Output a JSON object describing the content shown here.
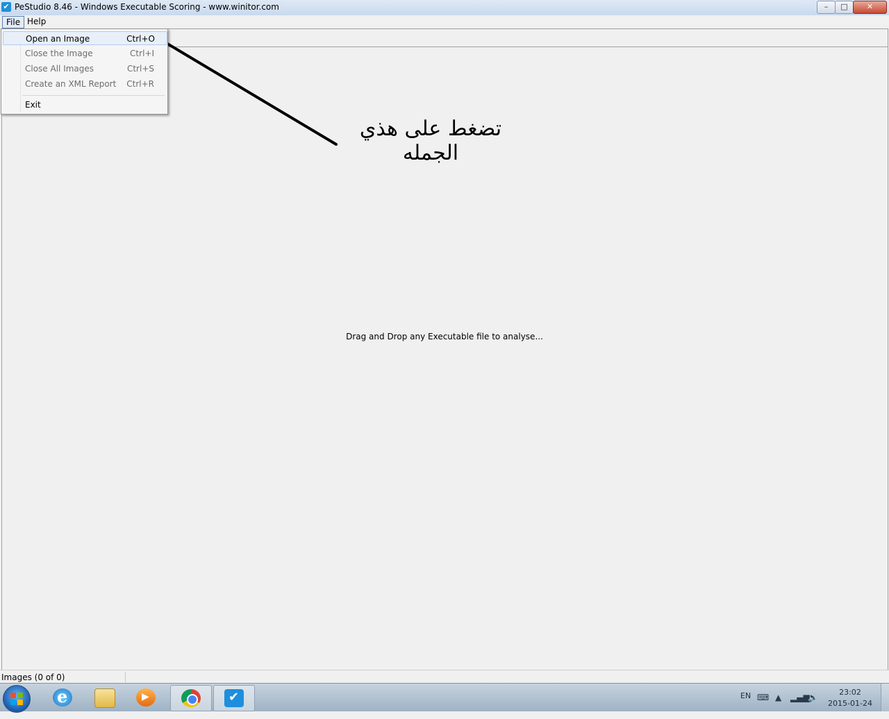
{
  "window": {
    "title": "PeStudio 8.46 - Windows Executable Scoring - www.winitor.com",
    "min_glyph": "–",
    "max_glyph": "□",
    "close_glyph": "✕"
  },
  "menubar": {
    "file": "File",
    "help": "Help"
  },
  "file_menu": {
    "items": [
      {
        "label": "Open an Image",
        "shortcut": "Ctrl+O",
        "enabled": true,
        "highlighted": true
      },
      {
        "label": "Close the Image",
        "shortcut": "Ctrl+I",
        "enabled": false
      },
      {
        "label": "Close All Images",
        "shortcut": "Ctrl+S",
        "enabled": false
      },
      {
        "label": "Create an XML Report",
        "shortcut": "Ctrl+R",
        "enabled": false
      },
      {
        "label": "Exit",
        "shortcut": "",
        "enabled": true
      }
    ]
  },
  "main": {
    "drop_hint": "Drag and Drop any Executable file to analyse..."
  },
  "annotation": {
    "text": "تضغط على هذي الجمله"
  },
  "statusbar": {
    "images": "Images (0 of 0)"
  },
  "taskbar": {
    "apps": [
      {
        "name": "internet-explorer-icon"
      },
      {
        "name": "file-explorer-icon"
      },
      {
        "name": "media-player-icon"
      },
      {
        "name": "chrome-icon"
      },
      {
        "name": "pestudio-icon",
        "active": true
      }
    ],
    "language": "EN",
    "time": "23:02",
    "date": "2015-01-24"
  }
}
